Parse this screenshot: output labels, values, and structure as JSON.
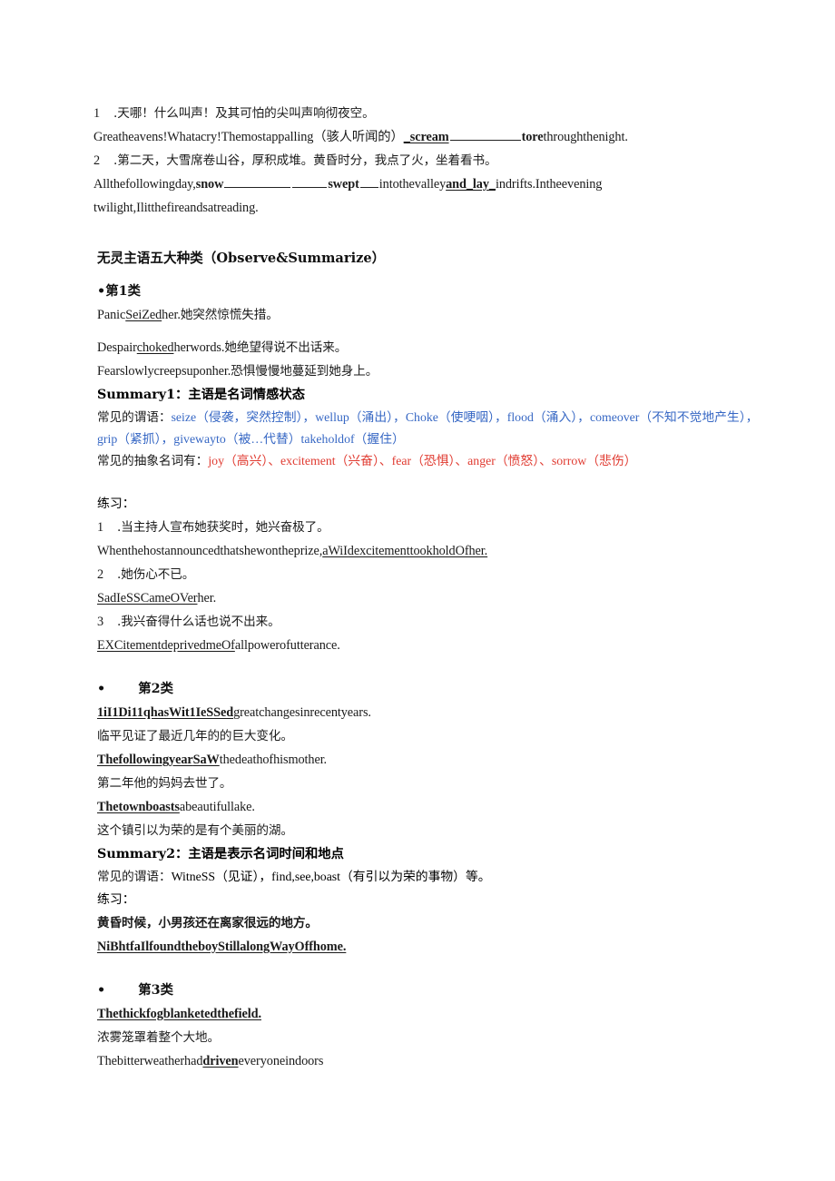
{
  "document": {
    "title": "无灵主语五大种类（Observe&Summarize）",
    "intro_exercises": [
      {
        "number": "1",
        "chinese": ".天哪！什么叫声！及其可怕的尖叫声响彻夜空。",
        "english_pre": "Greatheavens!Whatacry!Themostappalling（骇人听闻的）",
        "answer1": "_scream",
        "english_mid": "",
        "answer2": "tore",
        "english_post": "throughthenight."
      },
      {
        "number": "2",
        "chinese": ".第二天，大雪席卷山谷，厚积成堆。黄昏时分，我点了火，坐着看书。",
        "english_pre": "Allthefollowingday,",
        "answer1": "snow",
        "answer2": "swept",
        "english_mid": "intothevalley",
        "answer3": "and_lay_",
        "english_post": "indrifts.Intheevening",
        "english_wrap": "twilight,Ilitthefireandsatreading."
      }
    ],
    "categories": [
      {
        "bullet": "•",
        "label": "第1类",
        "tight": true,
        "examples": [
          {
            "pre": "Panic",
            "underlined": "SeiZed",
            "post": "her.",
            "chinese": "她突然惊慌失措。"
          },
          {
            "pre": "Despair",
            "underlined": "choked",
            "post": "herwords.",
            "chinese": "她绝望得说不出话来。"
          },
          {
            "pre": "Fearslowlycreepsuponher.",
            "underlined": "",
            "post": "",
            "chinese": "恐惧慢慢地蔓延到她身上。"
          }
        ],
        "summary": "Summary1：主语是名词情感状态",
        "predicates_label": "常见的谓语：",
        "predicates_text": "seize（侵袭，突然控制），wellup（涌出），Choke（使哽咽），flood（涌入），comeover（不知不觉地产生），grip（紧抓），givewayto（被…代替）takeholdof（握住）",
        "nouns_label": "常见的抽象名词有：",
        "nouns_text": "joy（高兴）、excitement（兴奋）、fear（恐惧）、anger（愤怒）、sorrow（悲伤）",
        "practice_label": "练习：",
        "practice": [
          {
            "number": "1",
            "chinese": ".当主持人宣布她获奖时，她兴奋极了。",
            "answer_pre": "Whenthehostannouncedthatshewontheprize,",
            "answer_underlined": "aWiIdexcitementtookholdOfher."
          },
          {
            "number": "2",
            "chinese": ".她伤心不已。",
            "answer_pre": "",
            "answer_underlined": "SadIeSSCameOVer",
            "answer_post": "her."
          },
          {
            "number": "3",
            "chinese": ".我兴奋得什么话也说不出来。",
            "answer_pre": "",
            "answer_underlined": "EXCitementdeprivedmeOf",
            "answer_post": "allpowerofutterance."
          }
        ]
      },
      {
        "bullet": "•",
        "label": "第2类",
        "tight": false,
        "examples": [
          {
            "underlined": "1iI1Di11qhasWit1IeSSed",
            "post": "greatchangesinrecentyears.",
            "chinese": "临平见证了最近几年的的巨大变化。"
          },
          {
            "underlined": "Thefollowingyear",
            "underlined2": "SaW",
            "post": "thedeathofhismother.",
            "chinese": "第二年他的妈妈去世了。"
          },
          {
            "underlined": "Thetownboasts",
            "post": "abeautifullake.",
            "chinese": "这个镇引以为荣的是有个美丽的湖。"
          }
        ],
        "summary": "Summary2：主语是表示名词时间和地点",
        "predicates_label": "常见的谓语：",
        "predicates_text": "WitneSS（见证），find,see,boast（有引以为荣的事物）等。",
        "practice_label": "练习：",
        "practice": [
          {
            "chinese": "黄昏时候，小男孩还在离家很远的地方。",
            "answer_underlined": "NiBhtfaIlfoundtheboyStillalongWayOffhome."
          }
        ]
      },
      {
        "bullet": "•",
        "label": "第3类",
        "tight": false,
        "examples": [
          {
            "underlined": "Thethickfogblanketedthefield.",
            "post": "",
            "chinese": "浓雾笼罩着整个大地。"
          },
          {
            "pre": "Thebitterweatherhad",
            "underlined": "driven",
            "post": "everyoneindoors",
            "chinese": ""
          }
        ]
      }
    ],
    "colors": {
      "blue": "#3667c4",
      "red": "#e03a30",
      "text": "#1a1a1a"
    }
  }
}
